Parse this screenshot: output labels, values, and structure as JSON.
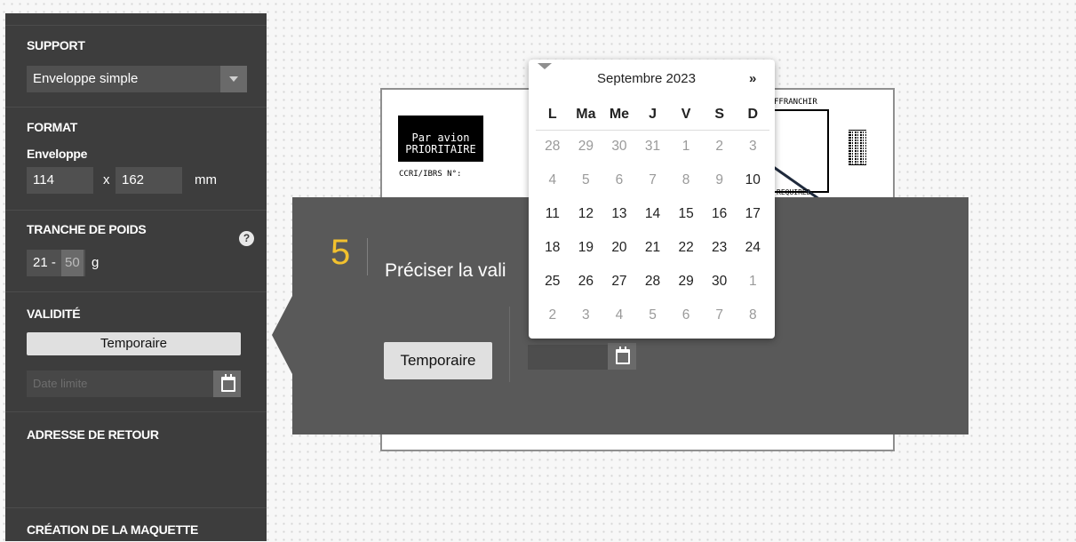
{
  "sidebar": {
    "support": {
      "title": "SUPPORT",
      "selected": "Enveloppe simple"
    },
    "format": {
      "title": "FORMAT",
      "subtitle": "Enveloppe",
      "width": "114",
      "sep": "x",
      "height": "162",
      "unit": "mm"
    },
    "poids": {
      "title": "TRANCHE DE POIDS",
      "help": "?",
      "min": "21 -",
      "max": "50",
      "unit": "g"
    },
    "validite": {
      "title": "VALIDITÉ",
      "button": "Temporaire",
      "date_placeholder": "Date limite"
    },
    "adresse": {
      "title": "ADRESSE DE RETOUR"
    },
    "creation": {
      "title": "CRÉATION DE LA MAQUETTE"
    }
  },
  "preview": {
    "label_line1": "Par avion",
    "label_line2": "PRIORITAIRE",
    "ccri": "CCRI/IBRS N°:",
    "stamp_top": "FFRANCHIR",
    "stamp_bottom": "REQUIRED"
  },
  "step": {
    "number": "5",
    "title": "Préciser la vali",
    "button": "Temporaire"
  },
  "datepicker": {
    "month": "Septembre 2023",
    "next": "»",
    "weekdays": [
      "L",
      "Ma",
      "Me",
      "J",
      "V",
      "S",
      "D"
    ],
    "weeks": [
      [
        {
          "d": "28",
          "m": 1
        },
        {
          "d": "29",
          "m": 1
        },
        {
          "d": "30",
          "m": 1
        },
        {
          "d": "31",
          "m": 1
        },
        {
          "d": "1",
          "m": 1
        },
        {
          "d": "2",
          "m": 1
        },
        {
          "d": "3",
          "m": 1
        }
      ],
      [
        {
          "d": "4",
          "m": 1
        },
        {
          "d": "5",
          "m": 1
        },
        {
          "d": "6",
          "m": 1
        },
        {
          "d": "7",
          "m": 1
        },
        {
          "d": "8",
          "m": 1
        },
        {
          "d": "9",
          "m": 1
        },
        {
          "d": "10",
          "m": 0
        }
      ],
      [
        {
          "d": "11",
          "m": 0
        },
        {
          "d": "12",
          "m": 0
        },
        {
          "d": "13",
          "m": 0
        },
        {
          "d": "14",
          "m": 0
        },
        {
          "d": "15",
          "m": 0
        },
        {
          "d": "16",
          "m": 0
        },
        {
          "d": "17",
          "m": 0
        }
      ],
      [
        {
          "d": "18",
          "m": 0
        },
        {
          "d": "19",
          "m": 0
        },
        {
          "d": "20",
          "m": 0
        },
        {
          "d": "21",
          "m": 0
        },
        {
          "d": "22",
          "m": 0
        },
        {
          "d": "23",
          "m": 0
        },
        {
          "d": "24",
          "m": 0
        }
      ],
      [
        {
          "d": "25",
          "m": 0
        },
        {
          "d": "26",
          "m": 0
        },
        {
          "d": "27",
          "m": 0
        },
        {
          "d": "28",
          "m": 0
        },
        {
          "d": "29",
          "m": 0
        },
        {
          "d": "30",
          "m": 0
        },
        {
          "d": "1",
          "m": 1
        }
      ],
      [
        {
          "d": "2",
          "m": 1
        },
        {
          "d": "3",
          "m": 1
        },
        {
          "d": "4",
          "m": 1
        },
        {
          "d": "5",
          "m": 1
        },
        {
          "d": "6",
          "m": 1
        },
        {
          "d": "7",
          "m": 1
        },
        {
          "d": "8",
          "m": 1
        }
      ]
    ]
  },
  "colors": {
    "accent": "#f2c12e",
    "sidebar": "#3d3d3d",
    "panel": "#595959"
  }
}
